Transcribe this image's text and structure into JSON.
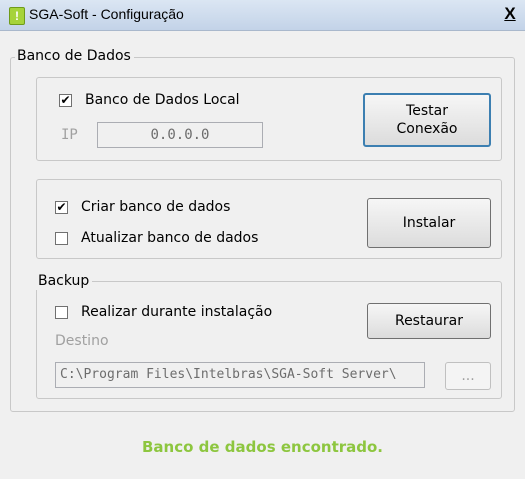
{
  "window": {
    "title": "SGA-Soft - Configuração",
    "close_label": "X",
    "app_icon": "!"
  },
  "db_group": {
    "legend": "Banco de Dados",
    "local": {
      "checkbox_checked": true,
      "check_mark": "✔",
      "label": "Banco de Dados Local",
      "ip_label": "IP",
      "ip_value": "0.0.0.0",
      "test_button_line1": "Testar",
      "test_button_line2": "Conexão"
    },
    "install": {
      "create_checked": true,
      "create_label": "Criar banco de dados",
      "update_checked": false,
      "update_label": "Atualizar banco de dados",
      "install_button": "Instalar"
    },
    "backup": {
      "legend": "Backup",
      "during_install_checked": false,
      "during_install_label": "Realizar durante instalação",
      "restore_button": "Restaurar",
      "destination_label": "Destino",
      "destination_value": "C:\\Program Files\\Intelbras\\SGA-Soft Server\\",
      "browse_button": "..."
    }
  },
  "status": {
    "text": "Banco de dados encontrado.",
    "color": "#8dc63f"
  }
}
